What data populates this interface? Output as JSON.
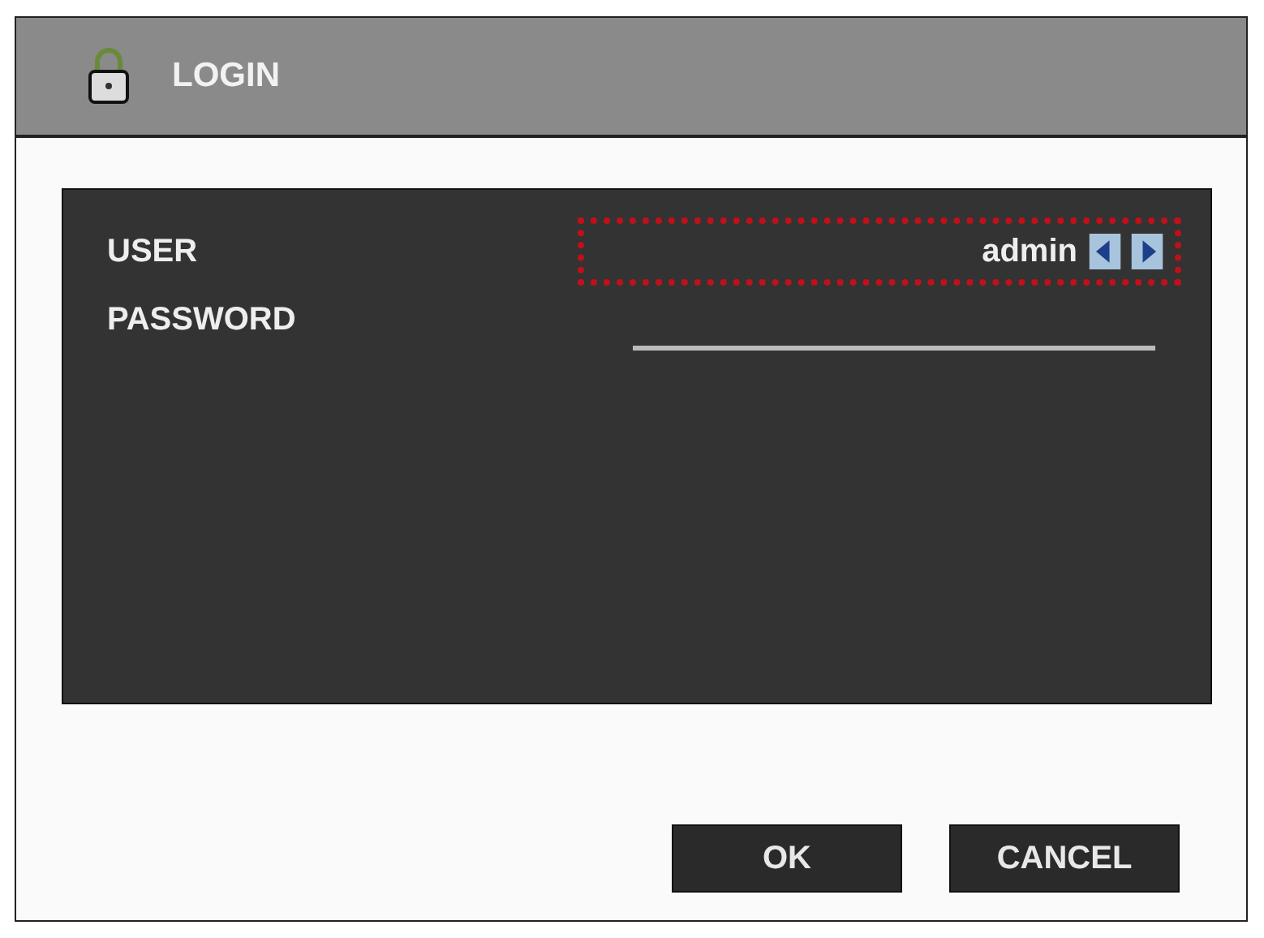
{
  "window": {
    "title": "LOGIN"
  },
  "fields": [
    {
      "label": "USER",
      "kind": "select",
      "value": "admin",
      "focused": true
    },
    {
      "label": "PASSWORD",
      "kind": "password",
      "focused": false
    }
  ],
  "buttons": [
    "OK",
    "CANCEL"
  ]
}
